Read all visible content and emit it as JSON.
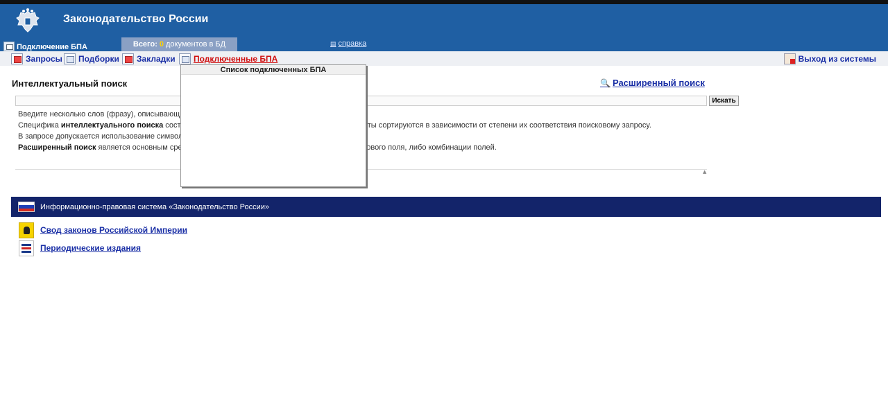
{
  "header": {
    "app_title": "Законодательство России",
    "connect_label": "Подключение БПА",
    "total_prefix": "Всего:",
    "total_count": "0",
    "total_suffix": "документов в БД",
    "help_label": "справка"
  },
  "toolbar": {
    "items": [
      {
        "label": "Запросы"
      },
      {
        "label": "Подборки"
      },
      {
        "label": "Закладки"
      },
      {
        "label": "Подключенные БПА"
      }
    ],
    "logout_label": "Выход из системы"
  },
  "dropdown": {
    "title": "Список подключенных БПА"
  },
  "search": {
    "title": "Интеллектуальный поиск",
    "advanced_label": "Расширенный поиск",
    "input_value": "",
    "button_label": "Искать",
    "help_lines": [
      {
        "pre": "Введите несколько слов (фразу), описывающи",
        "bold": "",
        "post": ""
      },
      {
        "pre": "Специфика ",
        "bold": "интеллектуального поиска",
        "post": " сост                                                                   м морфологии русского языка. Найденные результаты сортируются в зависимости от степени их соответствия поисковому запросу."
      },
      {
        "pre": "В запросе допускается использование символо                                                                   известных символов соответственно.",
        "bold": "",
        "post": ""
      },
      {
        "pre": "",
        "bold": "Расширенный поиск",
        "post": " является основным сре                                                                   нтов строятся путем заполнения какого-либо поискового поля, либо комбинации полей."
      }
    ]
  },
  "banner": {
    "text": "Информационно-правовая система «Законодательство России»"
  },
  "links": [
    {
      "label": "Свод законов Российской Империи",
      "icon": "imperial-eagle-icon"
    },
    {
      "label": "Периодические издания",
      "icon": "periodicals-icon"
    }
  ],
  "colors": {
    "header_bg": "#1f5fa3",
    "banner_bg": "#13246a",
    "link": "#1a2fa6",
    "active_link": "#d01010",
    "count": "#ffd200"
  }
}
